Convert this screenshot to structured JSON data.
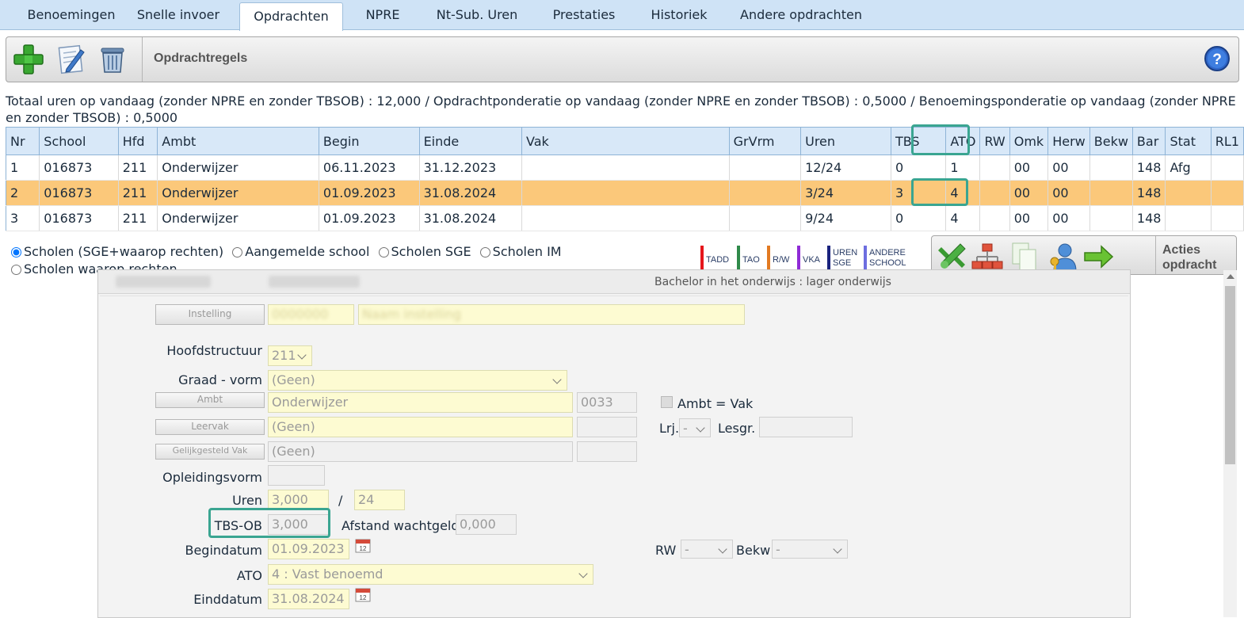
{
  "tabs": [
    {
      "label": "Benoemingen"
    },
    {
      "label": "Snelle invoer"
    },
    {
      "label": "Opdrachten"
    },
    {
      "label": "NPRE"
    },
    {
      "label": "Nt-Sub. Uren"
    },
    {
      "label": "Prestaties"
    },
    {
      "label": "Historiek"
    },
    {
      "label": "Andere opdrachten"
    }
  ],
  "toolbar": {
    "title": "Opdrachtregels",
    "add_icon": "add-icon",
    "edit_icon": "edit-icon",
    "delete_icon": "delete-icon",
    "help_icon": "help-icon"
  },
  "summary": "Totaal uren op vandaag (zonder NPRE en zonder TBSOB) : 12,000 / Opdrachtponderatie op vandaag (zonder NPRE en zonder TBSOB) : 0,5000 / Benoemingsponderatie op vandaag (zonder NPRE en zonder TBSOB) : 0,5000",
  "table": {
    "columns": [
      "Nr",
      "School",
      "Hfd",
      "Ambt",
      "Begin",
      "Einde",
      "Vak",
      "GrVrm",
      "Uren",
      "TBS",
      "ATO",
      "RW",
      "Omk",
      "Herw",
      "Bekw",
      "Bar",
      "Stat",
      "RL1"
    ],
    "rows": [
      [
        "1",
        "016873",
        "211",
        "Onderwijzer",
        "06.11.2023",
        "31.12.2023",
        "",
        "",
        "12/24",
        "0",
        "1",
        "",
        "00",
        "00",
        "",
        "148",
        "Afg",
        ""
      ],
      [
        "2",
        "016873",
        "211",
        "Onderwijzer",
        "01.09.2023",
        "31.08.2024",
        "",
        "",
        "3/24",
        "3",
        "4",
        "",
        "00",
        "00",
        "",
        "148",
        "",
        ""
      ],
      [
        "3",
        "016873",
        "211",
        "Onderwijzer",
        "01.09.2023",
        "31.08.2024",
        "",
        "",
        "9/24",
        "0",
        "4",
        "",
        "00",
        "00",
        "",
        "148",
        "",
        ""
      ]
    ],
    "selected_row": 2
  },
  "radios": {
    "options": [
      "Scholen (SGE+waarop rechten)",
      "Aangemelde school",
      "Scholen SGE",
      "Scholen IM",
      "Scholen waarop rechten"
    ],
    "selected": 0
  },
  "legend": [
    {
      "label": "TADD",
      "color": "#e5161b"
    },
    {
      "label": "TAO",
      "color": "#2f8a4a"
    },
    {
      "label": "R/W",
      "color": "#e27a22"
    },
    {
      "label": "VKA",
      "color": "#8f2bd6"
    },
    {
      "label": "UREN SGE",
      "color": "#1a237e"
    },
    {
      "label": "ANDERE SCHOOL",
      "color": "#6d6ee0"
    }
  ],
  "actions": {
    "title_line1": "Acties",
    "title_line2": "opdracht"
  },
  "detail": {
    "subtitle": "Bachelor in het onderwijs : lager onderwijs",
    "instelling_button": "Instelling",
    "ambt_button": "Ambt",
    "leervak_button": "Leervak",
    "gelijk_button": "Gelijkgesteld Vak",
    "hoofdstructuur_label": "Hoofdstructuur",
    "hoofdstructuur_value": "211",
    "graad_label": "Graad - vorm",
    "graad_value": "(Geen)",
    "ambt_value": "Onderwijzer",
    "ambt_code": "0033",
    "ambt_vak_label": "Ambt = Vak",
    "leervak_value": "(Geen)",
    "lrj_label": "Lrj.",
    "lrj_value": "-",
    "lesgr_label": "Lesgr.",
    "gelijk_value": "(Geen)",
    "opleidingsvorm_label": "Opleidingsvorm",
    "uren_label": "Uren",
    "uren_value": "3,000",
    "uren_slash": "/",
    "uren_total": "24",
    "tbs_label": "TBS-OB",
    "tbs_value": "3,000",
    "afstand_label": "Afstand wachtgeld",
    "afstand_value": "0,000",
    "begindatum_label": "Begindatum",
    "begindatum_value": "01.09.2023",
    "rw_label": "RW",
    "rw_value": "-",
    "bekw_label": "Bekw",
    "bekw_value": "-",
    "ato_label": "ATO",
    "ato_value": "4 : Vast benoemd",
    "einddatum_label": "Einddatum",
    "einddatum_value": "31.08.2024"
  }
}
